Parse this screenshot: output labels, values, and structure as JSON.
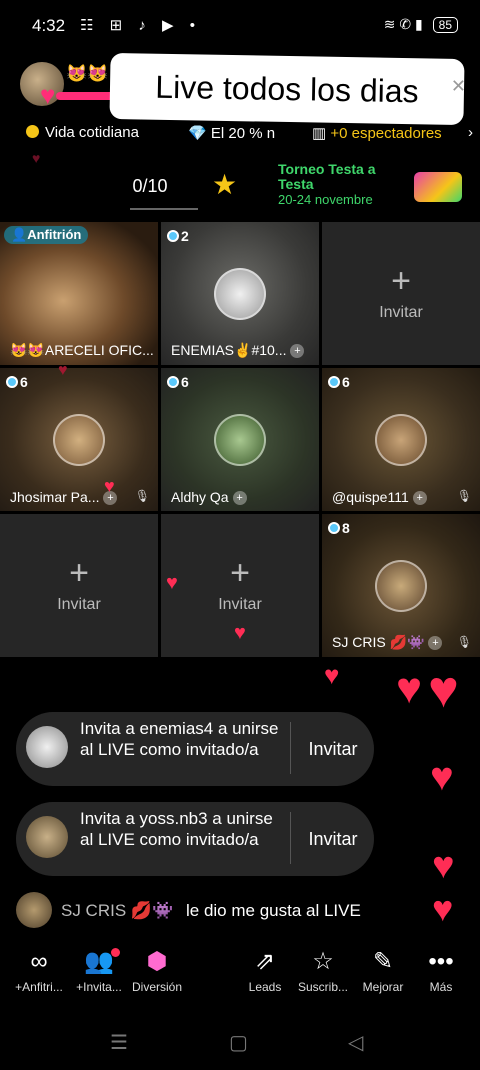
{
  "status": {
    "time": "4:32",
    "icons": "☷ ⊞ ♪ ▶ •",
    "battery": "85",
    "signal": "≋ ✆ ▮"
  },
  "header": {
    "emoji": "😻😻",
    "title": "Live todos  los dias",
    "category": "Vida cotidiana",
    "percent": "El 20 % n",
    "viewers": "+0 espectadores",
    "chevron": "›"
  },
  "counter": "0/10",
  "tournament": {
    "title": "Torneo Testa a Testa",
    "dates": "20-24 novembre"
  },
  "grid": {
    "host_badge": "Anfitrión",
    "host_name": "😻😻ARECELI OFIC...",
    "cells": [
      {
        "count": "2",
        "name": "ENEMIAS✌️#10..."
      },
      {
        "count": "6",
        "name": "Jhosimar Pa..."
      },
      {
        "count": "6",
        "name": "Aldhy Qa"
      },
      {
        "count": "6",
        "name": "@quispe111"
      },
      {
        "count": "8",
        "name": "SJ CRIS 💋👾"
      }
    ],
    "invite_label": "Invitar",
    "plus": "+"
  },
  "invites": [
    {
      "text": "Invita a enemias4 a unirse al LIVE como invitado/a",
      "button": "Invitar"
    },
    {
      "text": "Invita a yoss.nb3 a unirse al LIVE como invitado/a",
      "button": "Invitar"
    }
  ],
  "comment": {
    "user": "SJ CRIS 💋👾",
    "message": "le dio me gusta al LIVE"
  },
  "toolbar": [
    {
      "label": "+Anfitri...",
      "icon": "link-icon"
    },
    {
      "label": "+Invita...",
      "icon": "people-icon"
    },
    {
      "label": "Diversión",
      "icon": "cube-icon"
    },
    {
      "label": "Leads",
      "icon": "leads-icon"
    },
    {
      "label": "Suscrib...",
      "icon": "star-icon"
    },
    {
      "label": "Mejorar",
      "icon": "wand-icon"
    },
    {
      "label": "Más",
      "icon": "more-icon"
    }
  ],
  "colors": {
    "accent": "#ff2d55",
    "tournament": "#3fd66b",
    "badge": "#5ac8fa"
  }
}
